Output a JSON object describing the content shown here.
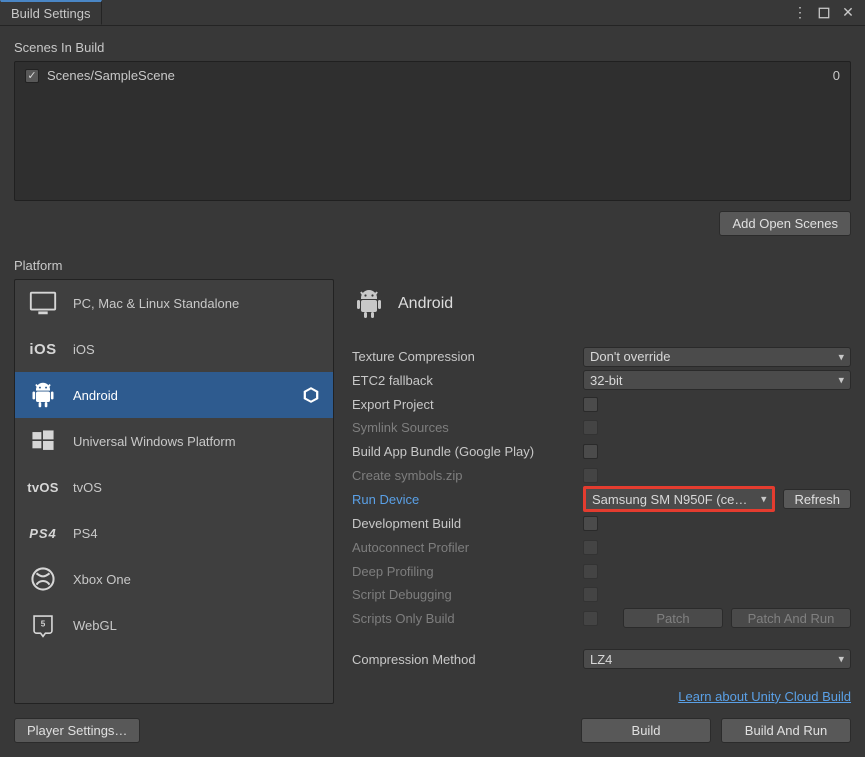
{
  "window": {
    "title": "Build Settings"
  },
  "scenes": {
    "header": "Scenes In Build",
    "items": [
      {
        "checked": true,
        "path": "Scenes/SampleScene",
        "index": "0"
      }
    ],
    "add_button": "Add Open Scenes"
  },
  "platforms": {
    "header": "Platform",
    "items": [
      {
        "id": "standalone",
        "label": "PC, Mac & Linux Standalone"
      },
      {
        "id": "ios",
        "label": "iOS"
      },
      {
        "id": "android",
        "label": "Android",
        "selected": true,
        "active": true
      },
      {
        "id": "uwp",
        "label": "Universal Windows Platform"
      },
      {
        "id": "tvos",
        "label": "tvOS"
      },
      {
        "id": "ps4",
        "label": "PS4"
      },
      {
        "id": "xboxone",
        "label": "Xbox One"
      },
      {
        "id": "webgl",
        "label": "WebGL"
      }
    ]
  },
  "detail": {
    "title": "Android",
    "texture_compression": {
      "label": "Texture Compression",
      "value": "Don't override"
    },
    "etc2_fallback": {
      "label": "ETC2 fallback",
      "value": "32-bit"
    },
    "export_project": {
      "label": "Export Project"
    },
    "symlink_sources": {
      "label": "Symlink Sources"
    },
    "app_bundle": {
      "label": "Build App Bundle (Google Play)"
    },
    "create_symbols": {
      "label": "Create symbols.zip"
    },
    "run_device": {
      "label": "Run Device",
      "value": "Samsung SM N950F (ce…",
      "refresh": "Refresh"
    },
    "dev_build": {
      "label": "Development Build"
    },
    "autoconnect": {
      "label": "Autoconnect Profiler"
    },
    "deep_profiling": {
      "label": "Deep Profiling"
    },
    "script_debug": {
      "label": "Script Debugging"
    },
    "scripts_only": {
      "label": "Scripts Only Build",
      "patch": "Patch",
      "patch_run": "Patch And Run"
    },
    "compression": {
      "label": "Compression Method",
      "value": "LZ4"
    },
    "learn_link": "Learn about Unity Cloud Build"
  },
  "footer": {
    "player_settings": "Player Settings…",
    "build": "Build",
    "build_run": "Build And Run"
  }
}
